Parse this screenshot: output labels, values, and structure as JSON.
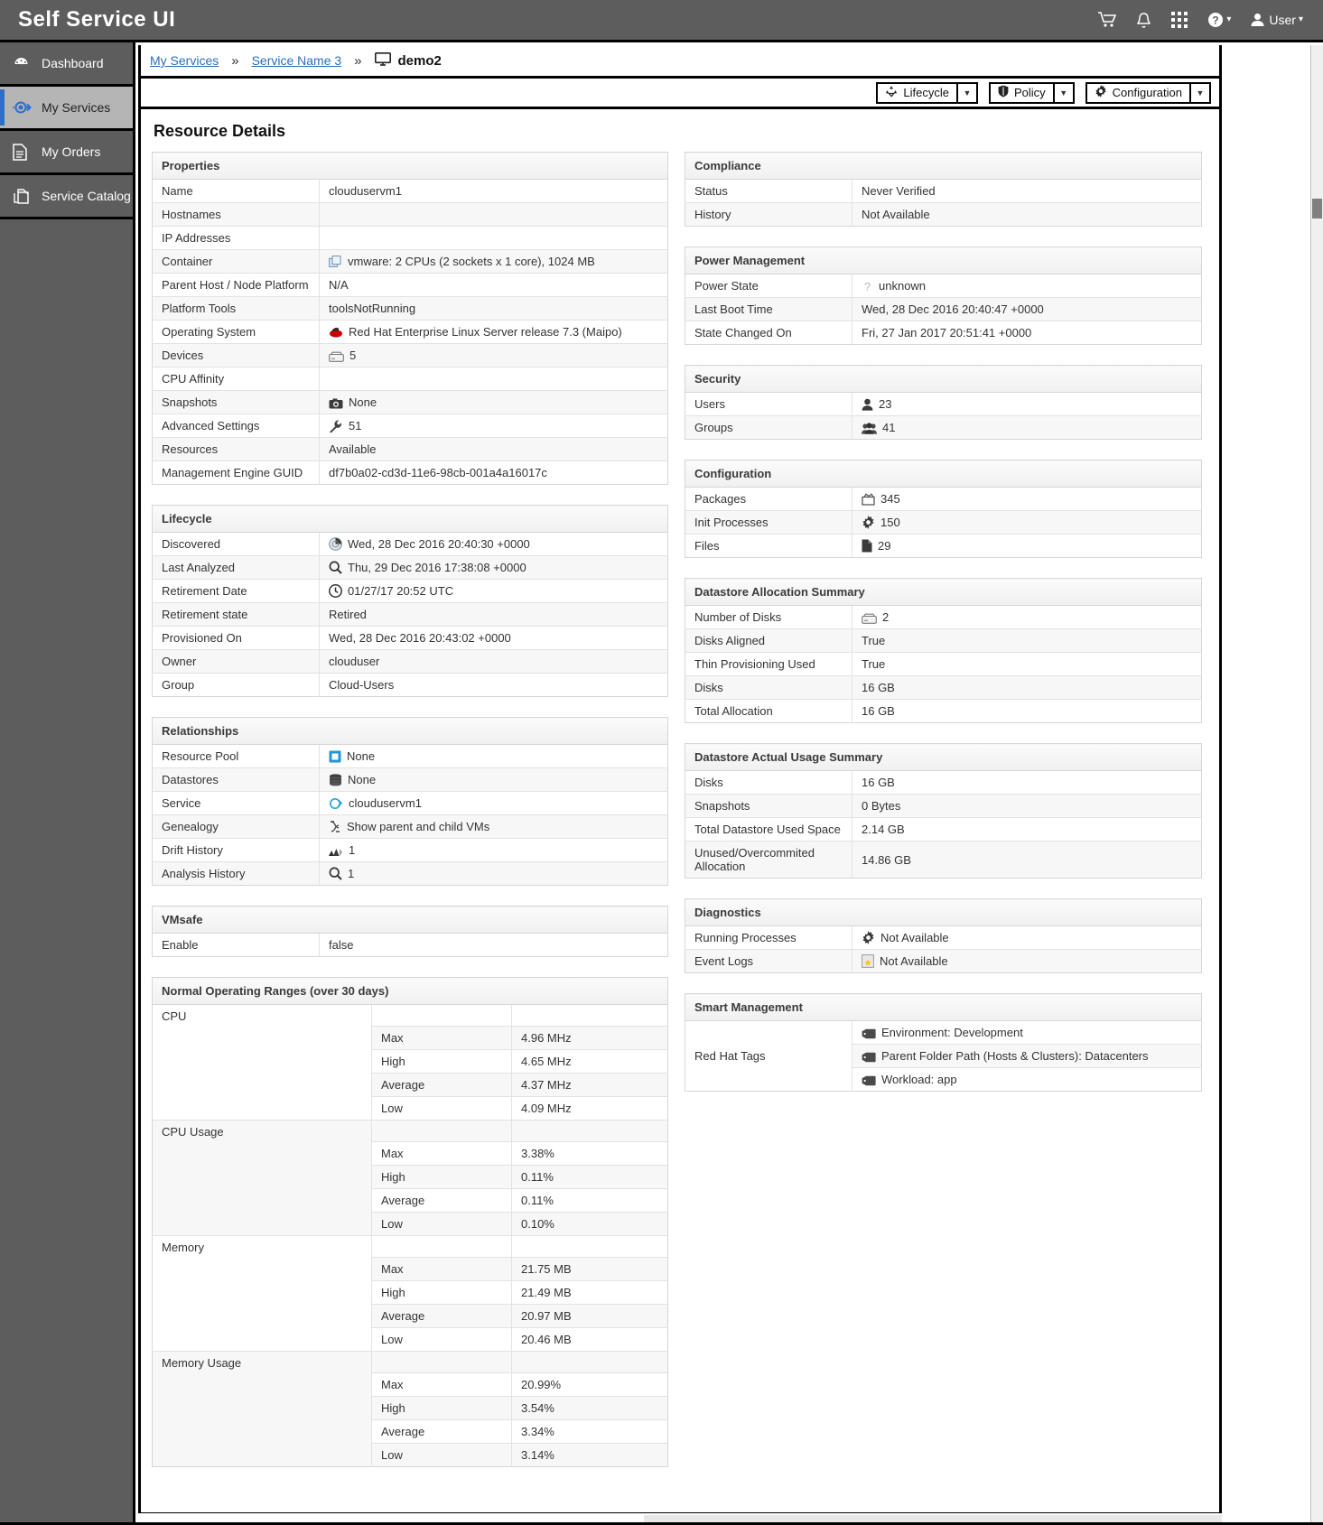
{
  "header": {
    "brand": "Self Service UI",
    "icons": [
      {
        "name": "cart-icon",
        "glyph": "cart"
      },
      {
        "name": "bell-icon",
        "glyph": "bell"
      },
      {
        "name": "grid-icon",
        "glyph": "grid"
      },
      {
        "name": "help-icon",
        "glyph": "help"
      }
    ],
    "user_label": "User"
  },
  "sidebar": {
    "items": [
      {
        "label": "Dashboard",
        "icon": "dashboard-icon",
        "active": false
      },
      {
        "label": "My Services",
        "icon": "my-services-icon",
        "active": true
      },
      {
        "label": "My Orders",
        "icon": "my-orders-icon",
        "active": false
      },
      {
        "label": "Service Catalog",
        "icon": "service-catalog-icon",
        "active": false
      }
    ]
  },
  "breadcrumb": {
    "items": [
      "My Services",
      "Service Name 3"
    ],
    "separator": "»",
    "current": "demo2"
  },
  "toolbar": {
    "buttons": [
      {
        "label": "Lifecycle",
        "icon": "lifecycle-icon"
      },
      {
        "label": "Policy",
        "icon": "shield-icon"
      },
      {
        "label": "Configuration",
        "icon": "gear-icon"
      }
    ],
    "caret": "▼"
  },
  "page": {
    "title": "Resource Details"
  },
  "panels": {
    "properties": {
      "title": "Properties",
      "rows": [
        {
          "key": "Name",
          "value": "clouduservm1",
          "icon": ""
        },
        {
          "key": "Hostnames",
          "value": "",
          "icon": ""
        },
        {
          "key": "IP Addresses",
          "value": "",
          "icon": ""
        },
        {
          "key": "Container",
          "value": "vmware: 2 CPUs (2 sockets x 1 core), 1024 MB",
          "icon": "vmware-icon"
        },
        {
          "key": "Parent Host / Node Platform",
          "value": "N/A",
          "icon": ""
        },
        {
          "key": "Platform Tools",
          "value": "toolsNotRunning",
          "icon": ""
        },
        {
          "key": "Operating System",
          "value": "Red Hat Enterprise Linux Server release 7.3 (Maipo)",
          "icon": "redhat-icon"
        },
        {
          "key": "Devices",
          "value": "5",
          "icon": "device-icon"
        },
        {
          "key": "CPU Affinity",
          "value": "",
          "icon": ""
        },
        {
          "key": "Snapshots",
          "value": "None",
          "icon": "camera-icon"
        },
        {
          "key": "Advanced Settings",
          "value": "51",
          "icon": "wrench-icon"
        },
        {
          "key": "Resources",
          "value": "Available",
          "icon": ""
        },
        {
          "key": "Management Engine GUID",
          "value": "df7b0a02-cd3d-11e6-98cb-001a4a16017c",
          "icon": ""
        }
      ]
    },
    "lifecycle": {
      "title": "Lifecycle",
      "rows": [
        {
          "key": "Discovered",
          "value": "Wed, 28 Dec 2016 20:40:30 +0000",
          "icon": "radar-icon"
        },
        {
          "key": "Last Analyzed",
          "value": "Thu, 29 Dec 2016 17:38:08 +0000",
          "icon": "magnifier-icon"
        },
        {
          "key": "Retirement Date",
          "value": "01/27/17 20:52 UTC",
          "icon": "clock-icon"
        },
        {
          "key": "Retirement state",
          "value": "Retired",
          "icon": ""
        },
        {
          "key": "Provisioned On",
          "value": "Wed, 28 Dec 2016 20:43:02 +0000",
          "icon": ""
        },
        {
          "key": "Owner",
          "value": "clouduser",
          "icon": ""
        },
        {
          "key": "Group",
          "value": "Cloud-Users",
          "icon": ""
        }
      ]
    },
    "relationships": {
      "title": "Relationships",
      "rows": [
        {
          "key": "Resource Pool",
          "value": "None",
          "icon": "resource-pool-icon"
        },
        {
          "key": "Datastores",
          "value": "None",
          "icon": "database-icon"
        },
        {
          "key": "Service",
          "value": "clouduservm1",
          "icon": "service-icon"
        },
        {
          "key": "Genealogy",
          "value": "Show parent and child VMs",
          "icon": "genealogy-icon"
        },
        {
          "key": "Drift History",
          "value": "1",
          "icon": "drift-icon"
        },
        {
          "key": "Analysis History",
          "value": "1",
          "icon": "magnifier-icon"
        }
      ]
    },
    "vmsafe": {
      "title": "VMsafe",
      "rows": [
        {
          "key": "Enable",
          "value": "false",
          "icon": ""
        }
      ]
    },
    "normal_ranges": {
      "title": "Normal Operating Ranges (over 30 days)",
      "groups": [
        {
          "name": "CPU",
          "rows": [
            {
              "label": "Max",
              "value": "4.96 MHz"
            },
            {
              "label": "High",
              "value": "4.65 MHz"
            },
            {
              "label": "Average",
              "value": "4.37 MHz"
            },
            {
              "label": "Low",
              "value": "4.09 MHz"
            }
          ]
        },
        {
          "name": "CPU Usage",
          "rows": [
            {
              "label": "Max",
              "value": "3.38%"
            },
            {
              "label": "High",
              "value": "0.11%"
            },
            {
              "label": "Average",
              "value": "0.11%"
            },
            {
              "label": "Low",
              "value": "0.10%"
            }
          ]
        },
        {
          "name": "Memory",
          "rows": [
            {
              "label": "Max",
              "value": "21.75 MB"
            },
            {
              "label": "High",
              "value": "21.49 MB"
            },
            {
              "label": "Average",
              "value": "20.97 MB"
            },
            {
              "label": "Low",
              "value": "20.46 MB"
            }
          ]
        },
        {
          "name": "Memory Usage",
          "rows": [
            {
              "label": "Max",
              "value": "20.99%"
            },
            {
              "label": "High",
              "value": "3.54%"
            },
            {
              "label": "Average",
              "value": "3.34%"
            },
            {
              "label": "Low",
              "value": "3.14%"
            }
          ]
        }
      ]
    },
    "compliance": {
      "title": "Compliance",
      "rows": [
        {
          "key": "Status",
          "value": "Never Verified",
          "icon": ""
        },
        {
          "key": "History",
          "value": "Not Available",
          "icon": ""
        }
      ]
    },
    "power_management": {
      "title": "Power Management",
      "rows": [
        {
          "key": "Power State",
          "value": "unknown",
          "icon": "question-icon"
        },
        {
          "key": "Last Boot Time",
          "value": "Wed, 28 Dec 2016 20:40:47 +0000",
          "icon": ""
        },
        {
          "key": "State Changed On",
          "value": "Fri, 27 Jan 2017 20:51:41 +0000",
          "icon": ""
        }
      ]
    },
    "security": {
      "title": "Security",
      "rows": [
        {
          "key": "Users",
          "value": "23",
          "icon": "user-icon"
        },
        {
          "key": "Groups",
          "value": "41",
          "icon": "users-icon"
        }
      ]
    },
    "configuration": {
      "title": "Configuration",
      "rows": [
        {
          "key": "Packages",
          "value": "345",
          "icon": "package-icon"
        },
        {
          "key": "Init Processes",
          "value": "150",
          "icon": "gear-icon"
        },
        {
          "key": "Files",
          "value": "29",
          "icon": "file-icon"
        }
      ]
    },
    "datastore_allocation": {
      "title": "Datastore Allocation Summary",
      "rows": [
        {
          "key": "Number of Disks",
          "value": "2",
          "icon": "device-icon"
        },
        {
          "key": "Disks Aligned",
          "value": "True",
          "icon": ""
        },
        {
          "key": "Thin Provisioning Used",
          "value": "True",
          "icon": ""
        },
        {
          "key": "Disks",
          "value": "16 GB",
          "icon": ""
        },
        {
          "key": "Total Allocation",
          "value": "16 GB",
          "icon": ""
        }
      ]
    },
    "datastore_usage": {
      "title": "Datastore Actual Usage Summary",
      "rows": [
        {
          "key": "Disks",
          "value": "16 GB",
          "icon": ""
        },
        {
          "key": "Snapshots",
          "value": "0 Bytes",
          "icon": ""
        },
        {
          "key": "Total Datastore Used Space",
          "value": "2.14 GB",
          "icon": ""
        },
        {
          "key": "Unused/Overcommited Allocation",
          "value": "14.86 GB",
          "icon": ""
        }
      ]
    },
    "diagnostics": {
      "title": "Diagnostics",
      "rows": [
        {
          "key": "Running Processes",
          "value": "Not Available",
          "icon": "gear-icon"
        },
        {
          "key": "Event Logs",
          "value": "Not Available",
          "icon": "eventlog-icon"
        }
      ]
    },
    "smart_management": {
      "title": "Smart Management",
      "key": "Red Hat Tags",
      "tags": [
        "Environment: Development",
        "Parent Folder Path (Hosts & Clusters): Datacenters",
        "Workload: app"
      ]
    }
  },
  "colors": {
    "chrome": "#5d5d5d",
    "accent": "#2d6ec9",
    "link": "#2a6ebb",
    "panel_header": "#f2f2f2"
  }
}
